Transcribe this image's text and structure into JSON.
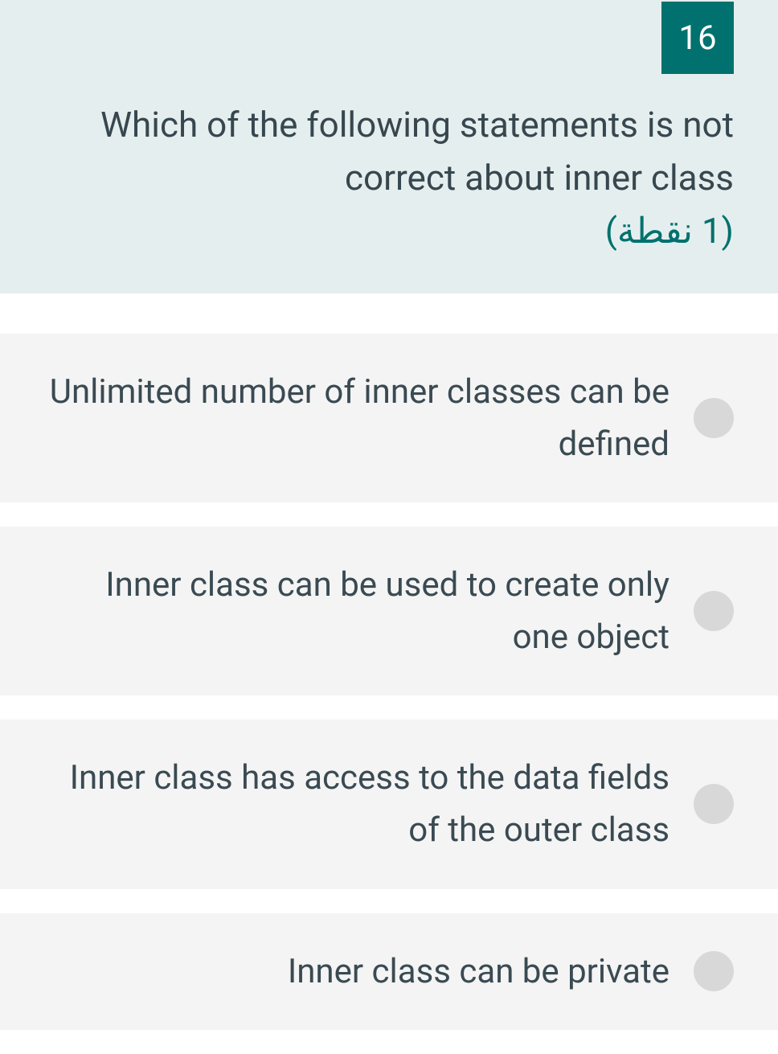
{
  "question": {
    "number": "16",
    "text": "Which of the following statements is not correct about inner class",
    "points": "(1 نقطة)"
  },
  "options": [
    {
      "text": "Unlimited number of inner classes can be defined"
    },
    {
      "text": "Inner class can be used to create only one object"
    },
    {
      "text": "Inner class has access to the data fields of the outer class"
    },
    {
      "text": "Inner class can be private"
    }
  ]
}
